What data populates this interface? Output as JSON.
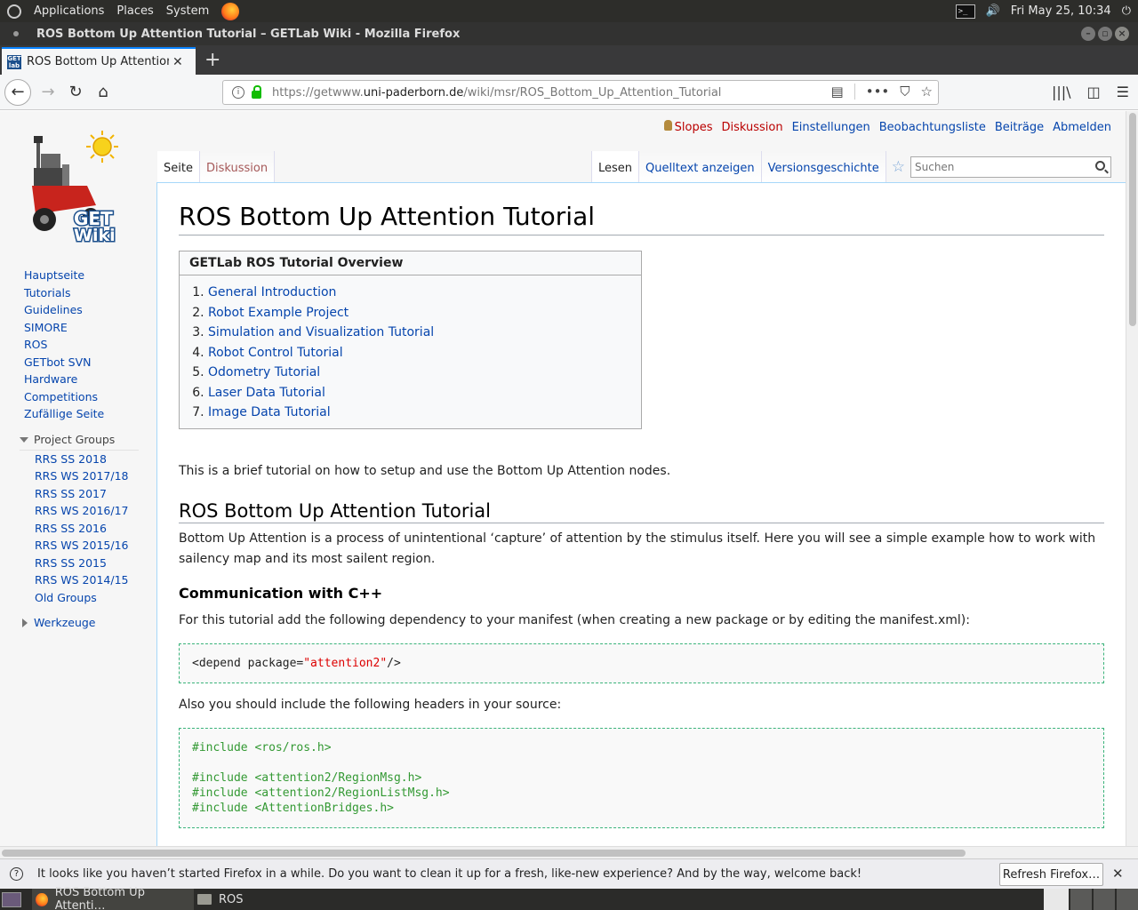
{
  "top_panel": {
    "menus": [
      "Applications",
      "Places",
      "System"
    ],
    "clock": "Fri May 25, 10:34"
  },
  "window": {
    "title": "ROS Bottom Up Attention Tutorial – GETLab Wiki - Mozilla Firefox"
  },
  "tab": {
    "label": "ROS Bottom Up Attention T",
    "favicon_text": "GET lab"
  },
  "urlbar": {
    "prefix": "https://getwww.",
    "domain": "uni-paderborn.de",
    "path": "/wiki/msr/ROS_Bottom_Up_Attention_Tutorial"
  },
  "personal_tools": {
    "user": "Slopes",
    "items": [
      "Diskussion",
      "Einstellungen",
      "Beobachtungsliste",
      "Beiträge",
      "Abmelden"
    ]
  },
  "page_tabs": {
    "left": [
      "Seite",
      "Diskussion"
    ],
    "right": [
      "Lesen",
      "Quelltext anzeigen",
      "Versionsgeschichte"
    ]
  },
  "search": {
    "placeholder": "Suchen"
  },
  "logo": {
    "text": "GET Wiki"
  },
  "sidebar": {
    "nav": [
      "Hauptseite",
      "Tutorials",
      "Guidelines",
      "SIMORE",
      "ROS",
      "GETbot SVN",
      "Hardware",
      "Competitions",
      "Zufällige Seite"
    ],
    "project_groups_label": "Project Groups",
    "project_groups": [
      "RRS SS 2018",
      "RRS WS 2017/18",
      "RRS SS 2017",
      "RRS WS 2016/17",
      "RRS SS 2016",
      "RRS WS 2015/16",
      "RRS SS 2015",
      "RRS WS 2014/15",
      "Old Groups"
    ],
    "tools_label": "Werkzeuge"
  },
  "content": {
    "title": "ROS Bottom Up Attention Tutorial",
    "toc_title": "GETLab ROS Tutorial Overview",
    "toc": [
      "General Introduction",
      "Robot Example Project",
      "Simulation and Visualization Tutorial",
      "Robot Control Tutorial",
      "Odometry Tutorial",
      "Laser Data Tutorial",
      "Image Data Tutorial"
    ],
    "intro": "This is a brief tutorial on how to setup and use the Bottom Up Attention nodes.",
    "h2": "ROS Bottom Up Attention Tutorial",
    "p1": "Bottom Up Attention is a process of unintentional ‘capture’ of attention by the stimulus itself. Here you will see a simple example how to work with sailency map and its most sailent region.",
    "h3": "Communication with C++",
    "p2": "For this tutorial add the following dependency to your manifest (when creating a new package or by editing the manifest.xml):",
    "code1_prefix": "<depend package=",
    "code1_string": "\"attention2\"",
    "code1_suffix": "/>",
    "p3": "Also you should include the following headers in your source:",
    "code2": [
      "#include <ros/ros.h>",
      "",
      "#include <attention2/RegionMsg.h>",
      "#include <attention2/RegionListMsg.h>",
      "#include <AttentionBridges.h>"
    ]
  },
  "notification": {
    "message": "It looks like you haven’t started Firefox in a while. Do you want to clean it up for a fresh, like-new experience? And by the way, welcome back!",
    "button": "Refresh Firefox…"
  },
  "taskbar": {
    "tasks": [
      "ROS Bottom Up Attenti…",
      "ROS"
    ]
  }
}
